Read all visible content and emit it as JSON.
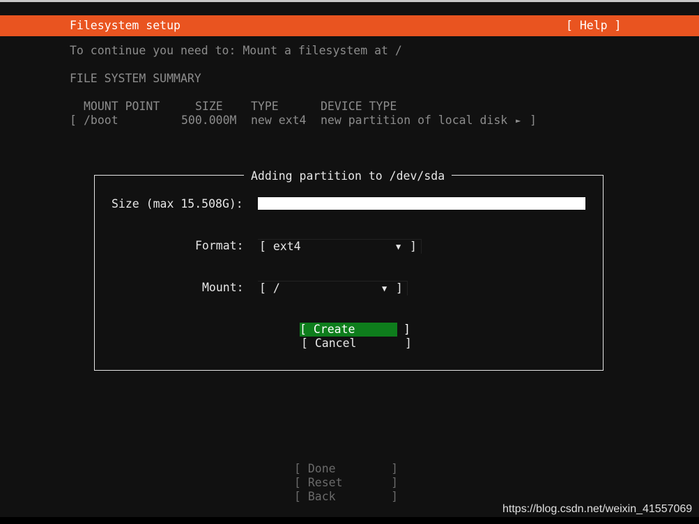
{
  "header": {
    "title": "Filesystem setup",
    "help_label": "[ Help ]"
  },
  "accent_color": "#e95420",
  "instruction": "To continue you need to: Mount a filesystem at /",
  "summary": {
    "heading": "FILE SYSTEM SUMMARY",
    "columns": [
      "MOUNT POINT",
      "SIZE",
      "TYPE",
      "DEVICE TYPE"
    ],
    "rows": [
      {
        "open": "[",
        "mount": "/boot",
        "size": "500.000M",
        "type": "new ext4",
        "device_type": "new partition of local disk",
        "arrow": "►",
        "close": "]"
      }
    ]
  },
  "dialog": {
    "title": "Adding partition to /dev/sda",
    "size_label": "Size (max 15.508G):",
    "size_value": "",
    "format_label": "Format:",
    "format_value": "[ ext4",
    "mount_label": "Mount:",
    "mount_value": "[ /",
    "dropdown_arrow": "▼",
    "close_bracket": "]",
    "create_label": "[ Create       ]",
    "cancel_label": "[ Cancel       ]"
  },
  "footer_buttons": {
    "done": "[ Done        ]",
    "reset": "[ Reset       ]",
    "back": "[ Back        ]"
  },
  "watermark": "https://blog.csdn.net/weixin_41557069"
}
